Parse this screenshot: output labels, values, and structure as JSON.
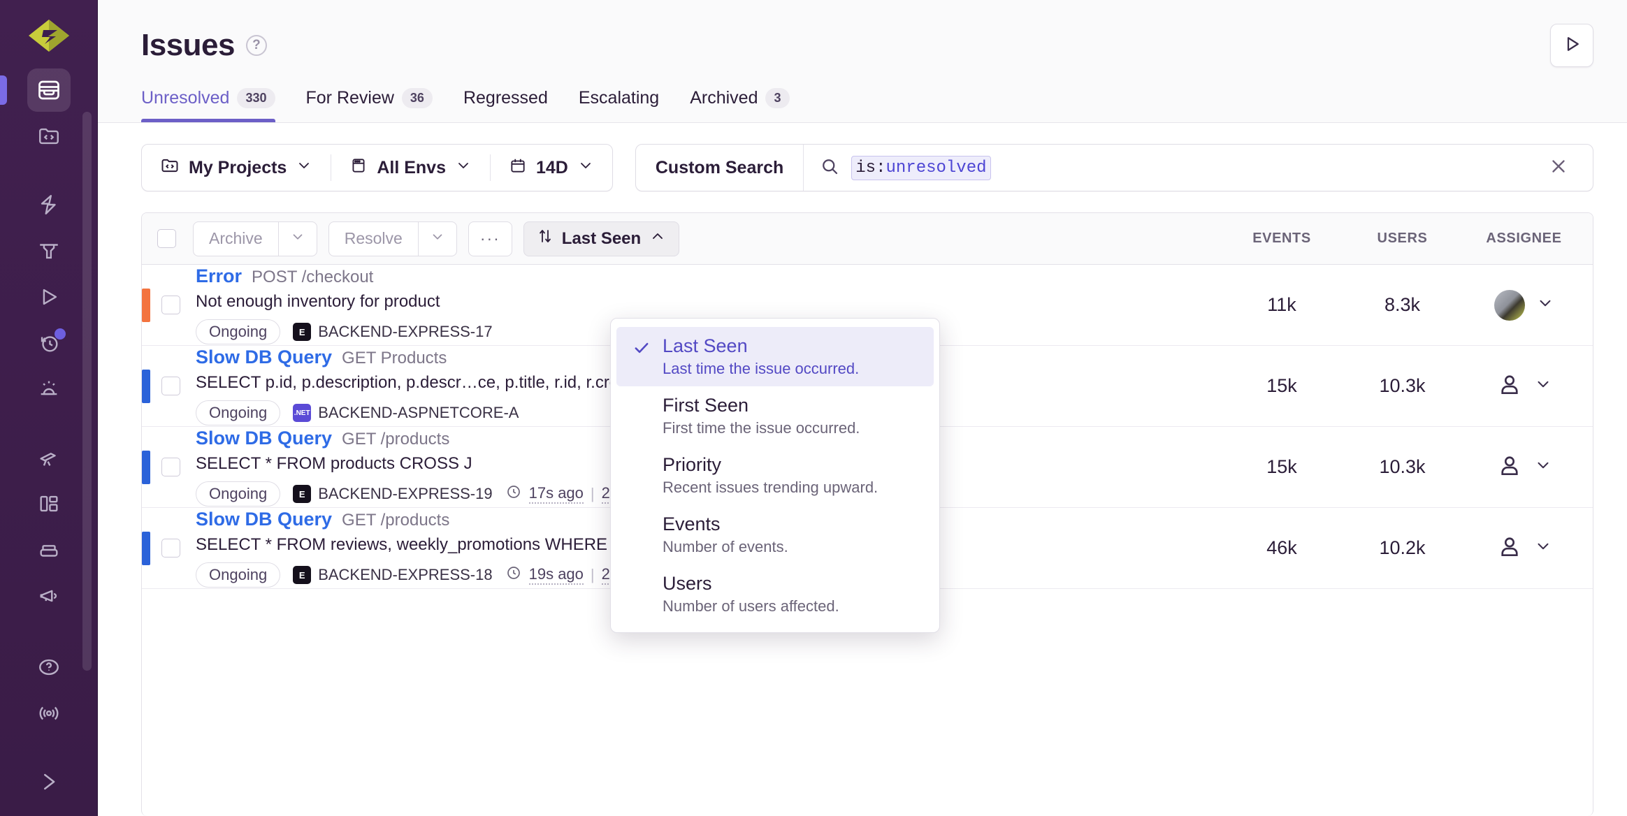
{
  "sidebar": {
    "logo_icon": "sentry-logo-icon",
    "items": [
      {
        "icon": "issues-inbox-icon",
        "name": "issues",
        "active": true,
        "badge": false
      },
      {
        "icon": "code-folder-icon",
        "name": "projects",
        "active": false,
        "badge": false
      },
      {
        "icon": "lightning-bolt-icon",
        "name": "performance",
        "active": false,
        "badge": false
      },
      {
        "icon": "funnel-icon",
        "name": "traces",
        "active": false,
        "badge": false
      },
      {
        "icon": "play-triangle-icon",
        "name": "replays",
        "active": false,
        "badge": false
      },
      {
        "icon": "history-clock-icon",
        "name": "releases",
        "active": false,
        "badge": true
      },
      {
        "icon": "siren-icon",
        "name": "alerts",
        "active": false,
        "badge": false
      },
      {
        "icon": "telescope-icon",
        "name": "discover",
        "active": false,
        "badge": false
      },
      {
        "icon": "dashboard-grid-icon",
        "name": "dashboards",
        "active": false,
        "badge": false
      },
      {
        "icon": "stack-layers-icon",
        "name": "insights",
        "active": false,
        "badge": false
      },
      {
        "icon": "megaphone-icon",
        "name": "feedback",
        "active": false,
        "badge": false
      }
    ],
    "bottom_items": [
      {
        "icon": "help-question-icon",
        "name": "help"
      },
      {
        "icon": "broadcast-icon",
        "name": "whats-new"
      }
    ],
    "expand_icon": "chevron-right-icon"
  },
  "header": {
    "title": "Issues",
    "help_icon": "question-mark-icon",
    "play_button_icon": "play-triangle-icon"
  },
  "tabs": [
    {
      "label": "Unresolved",
      "count": "330",
      "active": true
    },
    {
      "label": "For Review",
      "count": "36",
      "active": false
    },
    {
      "label": "Regressed",
      "count": "",
      "active": false
    },
    {
      "label": "Escalating",
      "count": "",
      "active": false
    },
    {
      "label": "Archived",
      "count": "3",
      "active": false
    }
  ],
  "filters": {
    "project": {
      "label": "My Projects",
      "icon": "code-folder-icon",
      "chevron": "chevron-down-icon"
    },
    "environment": {
      "label": "All Envs",
      "icon": "window-icon",
      "chevron": "chevron-down-icon"
    },
    "daterange": {
      "label": "14D",
      "icon": "calendar-icon",
      "chevron": "chevron-down-icon"
    }
  },
  "search": {
    "saved_label": "Custom Search",
    "icon": "search-icon",
    "token_key": "is:",
    "token_value": "unresolved",
    "clear_icon": "close-x-icon"
  },
  "toolbar": {
    "select_all_checkbox": "select-all",
    "archive_label": "Archive",
    "archive_chevron": "chevron-down-icon",
    "resolve_label": "Resolve",
    "resolve_chevron": "chevron-down-icon",
    "more_label": "···",
    "sort_icon": "sort-arrows-icon",
    "sort_label": "Last Seen",
    "sort_chevron": "chevron-up-icon",
    "columns": {
      "events": "EVENTS",
      "users": "USERS",
      "assignee": "ASSIGNEE"
    }
  },
  "sort_menu": {
    "items": [
      {
        "label": "Last Seen",
        "desc": "Last time the issue occurred.",
        "selected": true,
        "check_icon": "check-icon"
      },
      {
        "label": "First Seen",
        "desc": "First time the issue occurred.",
        "selected": false,
        "check_icon": ""
      },
      {
        "label": "Priority",
        "desc": "Recent issues trending upward.",
        "selected": false,
        "check_icon": ""
      },
      {
        "label": "Events",
        "desc": "Number of events.",
        "selected": false,
        "check_icon": ""
      },
      {
        "label": "Users",
        "desc": "Number of users affected.",
        "selected": false,
        "check_icon": ""
      }
    ]
  },
  "issues": [
    {
      "level_color": "#F3733F",
      "type": "Error",
      "culprit": "POST /checkout",
      "message": "Not enough inventory for product",
      "status_pill": "Ongoing",
      "project": "BACKEND-EXPRESS-17",
      "project_badge": "E",
      "project_badge_kind": "express",
      "last_seen": "",
      "age": "",
      "events": "11k",
      "users": "8.3k",
      "assignee_kind": "avatar",
      "assignee_chevron": "chevron-down-icon"
    },
    {
      "level_color": "#2B62D9",
      "type": "Slow DB Query",
      "culprit": "GET Products",
      "message": "SELECT p.id, p.description, p.descr…ce, p.title, r.id, r.created, r.custom…",
      "status_pill": "Ongoing",
      "project": "BACKEND-ASPNETCORE-A",
      "project_badge": ".NET",
      "project_badge_kind": "net",
      "last_seen": "",
      "age": "",
      "events": "15k",
      "users": "10.3k",
      "assignee_kind": "placeholder",
      "assignee_chevron": "chevron-down-icon"
    },
    {
      "level_color": "#2B62D9",
      "type": "Slow DB Query",
      "culprit": "GET /products",
      "message": "SELECT * FROM products CROSS J",
      "status_pill": "Ongoing",
      "project": "BACKEND-EXPRESS-19",
      "project_badge": "E",
      "project_badge_kind": "express",
      "last_seen": "17s ago",
      "age": "2mo old",
      "events": "15k",
      "users": "10.3k",
      "assignee_kind": "placeholder",
      "assignee_chevron": "chevron-down-icon"
    },
    {
      "level_color": "#2B62D9",
      "type": "Slow DB Query",
      "culprit": "GET /products",
      "message": "SELECT * FROM reviews, weekly_promotions WHERE productId = 3",
      "status_pill": "Ongoing",
      "project": "BACKEND-EXPRESS-18",
      "project_badge": "E",
      "project_badge_kind": "express",
      "last_seen": "19s ago",
      "age": "2mo old",
      "events": "46k",
      "users": "10.2k",
      "assignee_kind": "placeholder",
      "assignee_chevron": "chevron-down-icon"
    }
  ],
  "colors": {
    "sidebar_bg": "#3C1D4F",
    "accent": "#6C5FC7",
    "link": "#2E6BE6",
    "error_level": "#F3733F",
    "info_level": "#2B62D9"
  }
}
